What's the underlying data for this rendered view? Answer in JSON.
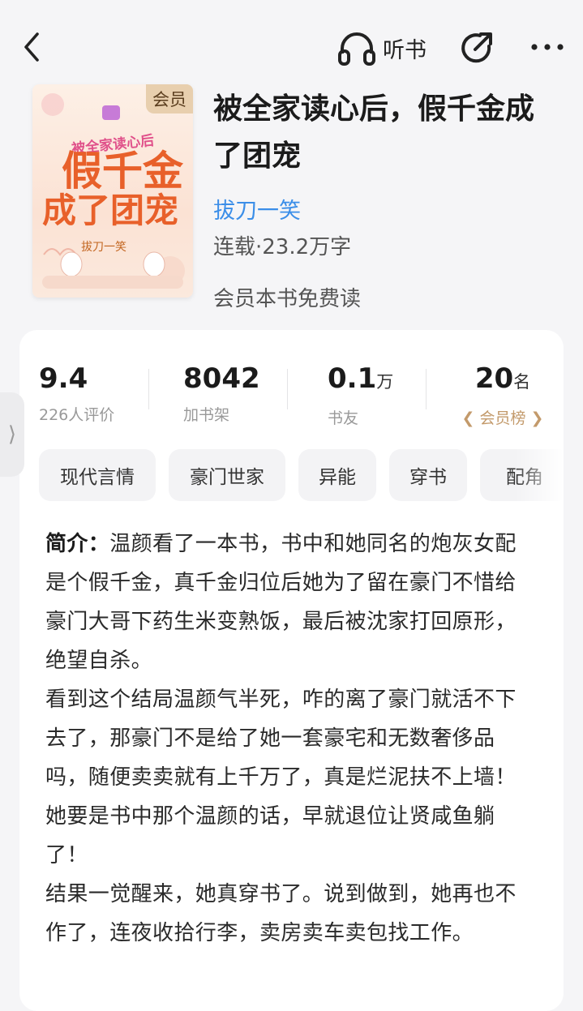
{
  "topbar": {
    "listen_label": "听书",
    "icons": [
      "chevron-left-icon",
      "headphones-icon",
      "share-icon",
      "more-icon"
    ]
  },
  "book": {
    "cover_badge": "会员",
    "cover_title_small": "被全家读心后",
    "cover_title_line1": "假千金",
    "cover_title_line2": "成了团宠",
    "cover_author": "拔刀一笑",
    "title": "被全家读心后，假千金成了团宠",
    "author": "拔刀一笑",
    "meta": "连载·23.2万字",
    "vip_note": "会员本书免费读"
  },
  "stats": [
    {
      "value": "9.4",
      "unit": "",
      "label": "226人评价"
    },
    {
      "value": "8042",
      "unit": "",
      "label": "加书架"
    },
    {
      "value": "0.1",
      "unit": "万",
      "label": "书友"
    },
    {
      "value": "20",
      "unit": "名",
      "label": "会员榜"
    }
  ],
  "tags": [
    "现代言情",
    "豪门世家",
    "异能",
    "穿书",
    "配角"
  ],
  "intro": {
    "label": "简介：",
    "text": "温颜看了一本书，书中和她同名的炮灰女配是个假千金，真千金归位后她为了留在豪门不惜给豪门大哥下药生米变熟饭，最后被沈家打回原形，绝望自杀。\n看到这个结局温颜气半死，咋的离了豪门就活不下去了，那豪门不是给了她一套豪宅和无数奢侈品吗，随便卖卖就有上千万了，真是烂泥扶不上墙！\n她要是书中那个温颜的话，早就退位让贤咸鱼躺了！\n结果一觉醒来，她真穿书了。说到做到，她再也不作了，连夜收拾行李，卖房卖车卖包找工作。"
  },
  "colors": {
    "author_link": "#3b8ee8",
    "rank_gold": "#c39a6b",
    "background": "#f5f5f7"
  }
}
